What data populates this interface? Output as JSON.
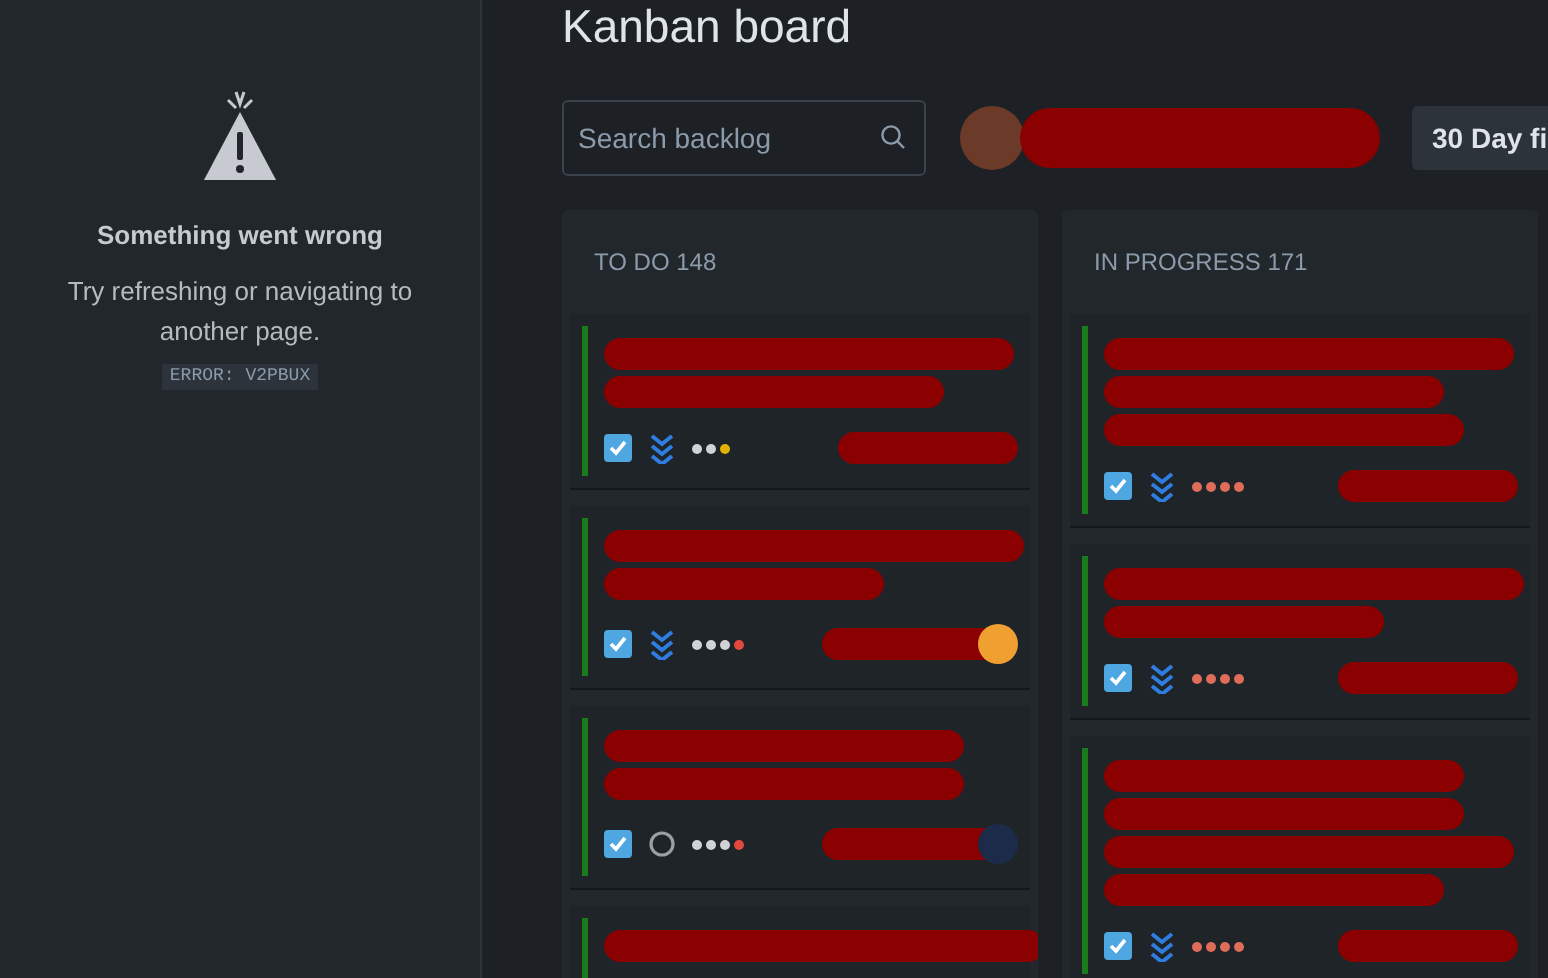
{
  "error_panel": {
    "title": "Something went wrong",
    "message": "Try refreshing or navigating to another page.",
    "code": "ERROR: V2PBUX"
  },
  "header": {
    "title": "Kanban board",
    "search": {
      "placeholder": "Search backlog"
    },
    "filter_button": "30 Day fi"
  },
  "columns": [
    {
      "name": "TO DO",
      "count": "148",
      "cards": [
        {
          "kind": "lowest",
          "dots": [
            {
              "color": "#cfd3d8"
            },
            {
              "color": "#cfd3d8"
            },
            {
              "color": "#e2b203"
            }
          ]
        },
        {
          "kind": "lowest",
          "dots": [
            {
              "color": "#cfd3d8"
            },
            {
              "color": "#cfd3d8"
            },
            {
              "color": "#cfd3d8"
            },
            {
              "color": "#e2483d"
            }
          ],
          "avatar": {
            "color": "#f0a030"
          }
        },
        {
          "kind": "none",
          "dots": [
            {
              "color": "#cfd3d8"
            },
            {
              "color": "#cfd3d8"
            },
            {
              "color": "#cfd3d8"
            },
            {
              "color": "#e2483d"
            }
          ],
          "avatar": {
            "color": "#1c2b4a"
          }
        },
        {
          "kind": "title"
        }
      ]
    },
    {
      "name": "IN PROGRESS",
      "count": "171",
      "cards": [
        {
          "kind": "lowest",
          "dots": [
            {
              "color": "#e06c5a"
            },
            {
              "color": "#e06c5a"
            },
            {
              "color": "#e06c5a"
            },
            {
              "color": "#e06c5a"
            }
          ]
        },
        {
          "kind": "lowest",
          "dots": [
            {
              "color": "#e06c5a"
            },
            {
              "color": "#e06c5a"
            },
            {
              "color": "#e06c5a"
            },
            {
              "color": "#e06c5a"
            }
          ]
        },
        {
          "kind": "lowest",
          "dots": [
            {
              "color": "#e06c5a"
            },
            {
              "color": "#e06c5a"
            },
            {
              "color": "#e06c5a"
            },
            {
              "color": "#e06c5a"
            }
          ]
        }
      ]
    }
  ]
}
